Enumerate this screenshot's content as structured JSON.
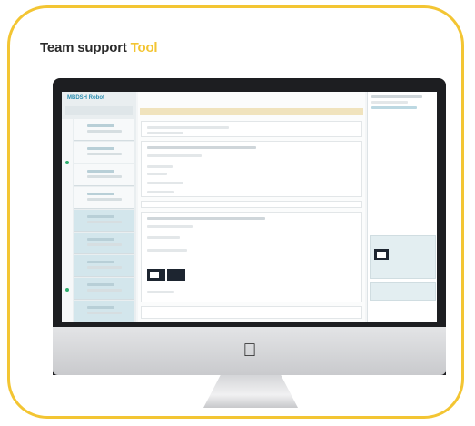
{
  "title": {
    "main": "Team support",
    "accent": "Tool"
  },
  "colors": {
    "border": "#f3c533",
    "accent": "#f3c533",
    "brand": "#2d8eb0"
  },
  "app": {
    "logo": "MBDSH Robot"
  }
}
